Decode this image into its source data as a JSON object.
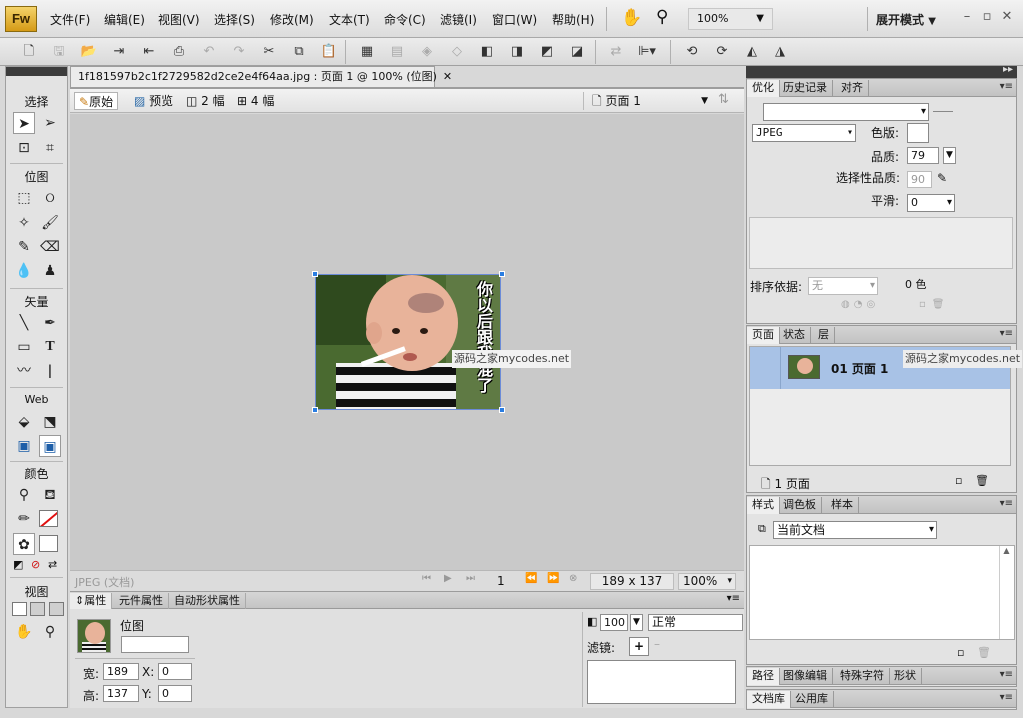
{
  "app": {
    "logo": "Fw",
    "expand_mode": "展开模式",
    "zoom": "100%"
  },
  "menu": [
    "文件(F)",
    "编辑(E)",
    "视图(V)",
    "选择(S)",
    "修改(M)",
    "文本(T)",
    "命令(C)",
    "滤镜(I)",
    "窗口(W)",
    "帮助(H)"
  ],
  "tools": {
    "sections": [
      "选择",
      "位图",
      "矢量",
      "Web",
      "颜色",
      "视图"
    ]
  },
  "document": {
    "tab_title": "1f181597b2c1f2729582d2ce2e4f64aa.jpg : 页面 1 @ 100% (位图)",
    "views": {
      "original": "原始",
      "preview": "预览",
      "two_up": "2 幅",
      "four_up": "4 幅"
    },
    "page_select": "页面 1",
    "image_text": "你以后跟我混了",
    "watermark": "源码之家mycodes.net",
    "status": {
      "format": "JPEG (文档)",
      "page_num": "1",
      "size": "189 x 137",
      "zoom": "100%"
    }
  },
  "properties": {
    "tabs": [
      "属性",
      "元件属性",
      "自动形状属性"
    ],
    "type": "位图",
    "width_label": "宽:",
    "width": "189",
    "height_label": "高:",
    "height": "137",
    "x_label": "X:",
    "x": "0",
    "y_label": "Y:",
    "y": "0",
    "opacity": "100",
    "blend": "正常",
    "filter_label": "滤镜:"
  },
  "optimize": {
    "tabs": [
      "优化",
      "历史记录",
      "对齐"
    ],
    "format": "JPEG",
    "matte_label": "色版:",
    "quality_label": "品质:",
    "quality": "79",
    "selective_label": "选择性品质:",
    "selective": "90",
    "smooth_label": "平滑:",
    "smooth": "0",
    "sort_label": "排序依据:",
    "sort": "无",
    "colors": "0 色"
  },
  "pages": {
    "tabs": [
      "页面",
      "状态",
      "层"
    ],
    "row_label": "01 页面 1",
    "watermark": "源码之家mycodes.net",
    "footer": "1 页面"
  },
  "styles": {
    "tabs": [
      "样式",
      "调色板",
      "样本"
    ],
    "select": "当前文档"
  },
  "bottom_tabs": [
    "路径",
    "图像编辑",
    "特殊字符",
    "形状"
  ],
  "library_tabs": [
    "文档库",
    "公用库"
  ]
}
